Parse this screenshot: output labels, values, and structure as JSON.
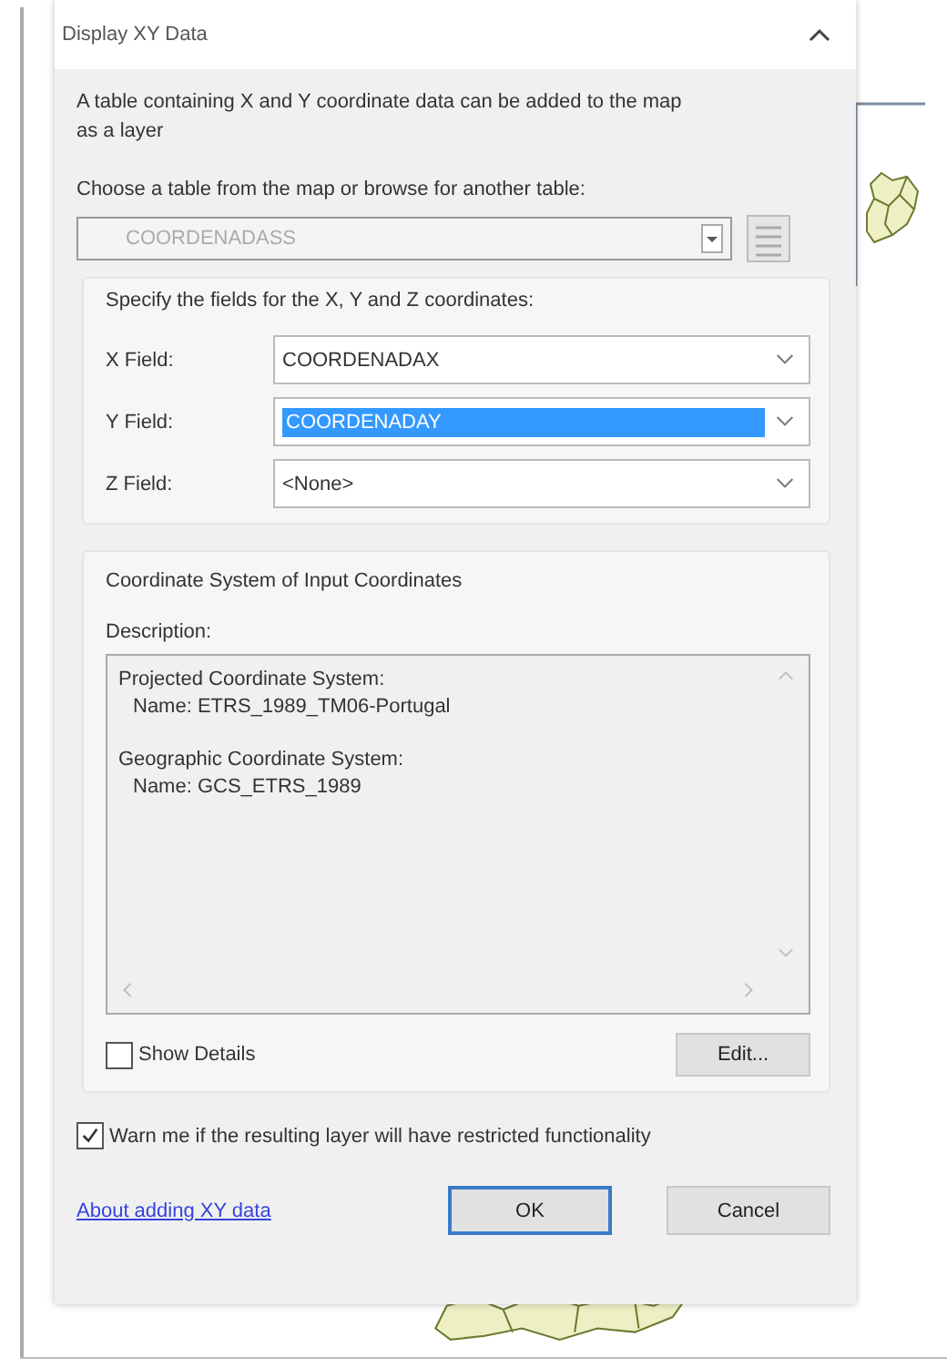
{
  "window": {
    "title": "Display XY Data"
  },
  "intro": "A table containing X and Y coordinate data can be added to the map as a layer",
  "table_prompt": "Choose a table from the map or browse for another table:",
  "table_select": {
    "value": "COORDENADASS",
    "disabled": true
  },
  "fields_group": {
    "title": "Specify the fields for the X, Y and Z coordinates:",
    "fields": [
      {
        "label": "X Field:",
        "value": "COORDENADAX",
        "selected": false
      },
      {
        "label": "Y Field:",
        "value": "COORDENADAY",
        "selected": true
      },
      {
        "label": "Z Field:",
        "value": "<None>",
        "selected": false
      }
    ]
  },
  "coordinate_group": {
    "title": "Coordinate System of Input Coordinates",
    "description_label": "Description:",
    "blocks": [
      {
        "heading": "Projected Coordinate System:",
        "name": "Name: ETRS_1989_TM06-Portugal"
      },
      {
        "heading": "Geographic Coordinate System:",
        "name": "Name: GCS_ETRS_1989"
      }
    ],
    "show_details": {
      "label": "Show Details",
      "checked": false
    },
    "edit_button": "Edit..."
  },
  "warn": {
    "label": "Warn me if the resulting layer will have restricted functionality",
    "checked": true
  },
  "help_link": "About adding XY data",
  "buttons": [
    {
      "label": "OK",
      "default": true
    },
    {
      "label": "Cancel",
      "default": false
    }
  ]
}
